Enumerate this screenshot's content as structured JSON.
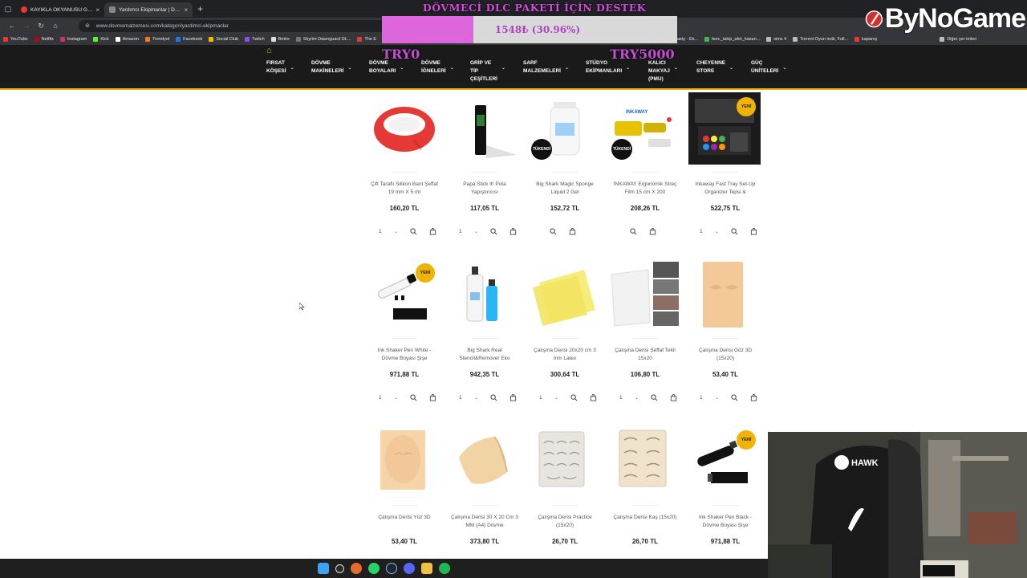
{
  "browser": {
    "tabs": [
      {
        "title": "KAYIKLA OKYANUSU GEÇMEYI...",
        "active": false
      },
      {
        "title": "Yardımcı Ekipmanlar | Dövme M...",
        "active": true
      }
    ],
    "url": "www.dovmemalzemesi.com/kategori/yardimci-ekipmanlar",
    "bookmarks": [
      "YouTube",
      "Netflix",
      "Instagram",
      "Kick",
      "Amazon",
      "Trendyol",
      "Facebook",
      "Social Club",
      "Twitch",
      "Botrix",
      "Skyrim Dawnguard DL...",
      "The E"
    ],
    "bookmarks_right": [
      "asty - Ek...",
      "borc_takip_afet_hasan...",
      "sims 4",
      "Torrent Oyun indir, Full...",
      "kapanış",
      "Diğer yer imleri"
    ]
  },
  "site_nav": {
    "items": [
      "FIRSAT\nKÖŞESİ",
      "DÖVME\nMAKİNELERİ",
      "DÖVME\nBOYALARI",
      "DÖVME\nİĞNELERİ",
      "GRİP VE\nTİP\nÇEŞİTLERİ",
      "SARF\nMALZEMELERİ",
      "STÜDYO\nEKİPMANLARI",
      "KALICI\nMAKYAJ\n(PMU)",
      "CHEYENNE\nSTORE",
      "GÜÇ\nÜNİTELERİ"
    ]
  },
  "overlay": {
    "title": "DÖVMECİ DLC PAKETİ İÇİN DESTEK",
    "progress_text": "1548₺ (30.96%)",
    "progress_fraction": 0.3096,
    "goal_start": "TRY0",
    "goal_end": "TRY5000",
    "brand": "ByNoGame"
  },
  "labels": {
    "yeni": "YENİ",
    "tukendi": "TÜKENDİ",
    "qty_default": "1"
  },
  "products": [
    {
      "name": "Çift Taraflı Silikon Bant Şeffaf 19 mm X 5 mt",
      "price": "160,20 TL"
    },
    {
      "name": "Papa Stick It! Pota Yapıştırıcısı",
      "price": "117,05 TL"
    },
    {
      "name": "Big Shark Magic Sponge Liquid 2 Gel",
      "price": "152,72 TL"
    },
    {
      "name": "INKAWAY Ergonomik Streç Film 15 cm X 200",
      "price": "208,26 TL"
    },
    {
      "name": "Inkaway Fast Tray Set-Up Organizer Tepsi &",
      "price": "522,75 TL"
    },
    {
      "name": "Ink Shaker Pen White - Dövme Boyası Şişe",
      "price": "971,88 TL"
    },
    {
      "name": "Big Shark Real Stencil&Remover Eko",
      "price": "942,35 TL"
    },
    {
      "name": "Çalışma Derisi 20x20 cm 3 mm Latex",
      "price": "300,64 TL"
    },
    {
      "name": "Çalışma Derisi Şeffaf Tekli 15x20",
      "price": "106,80 TL"
    },
    {
      "name": "Çalışma Derisi Göz 3D (15x20)",
      "price": "53,40 TL"
    },
    {
      "name": "Çalışma Derisi Yüz 3D",
      "price": "53,40 TL"
    },
    {
      "name": "Çalışma Derisi 30 X 20 Cm 3 MM (A4) Dövme",
      "price": "373,80 TL"
    },
    {
      "name": "Çalışma Derisi Practice (15x20)",
      "price": "26,70 TL"
    },
    {
      "name": "Çalışma Derisi Kaş (15x20)",
      "price": "26,70 TL"
    },
    {
      "name": "Ink Shaker Pen Black - Dövme Boyası Şişe",
      "price": "971,88 TL"
    }
  ],
  "colors": {
    "accent": "#f0b400",
    "overlay_purple": "#d24bd8",
    "nav_bg": "#1a1a1a"
  }
}
